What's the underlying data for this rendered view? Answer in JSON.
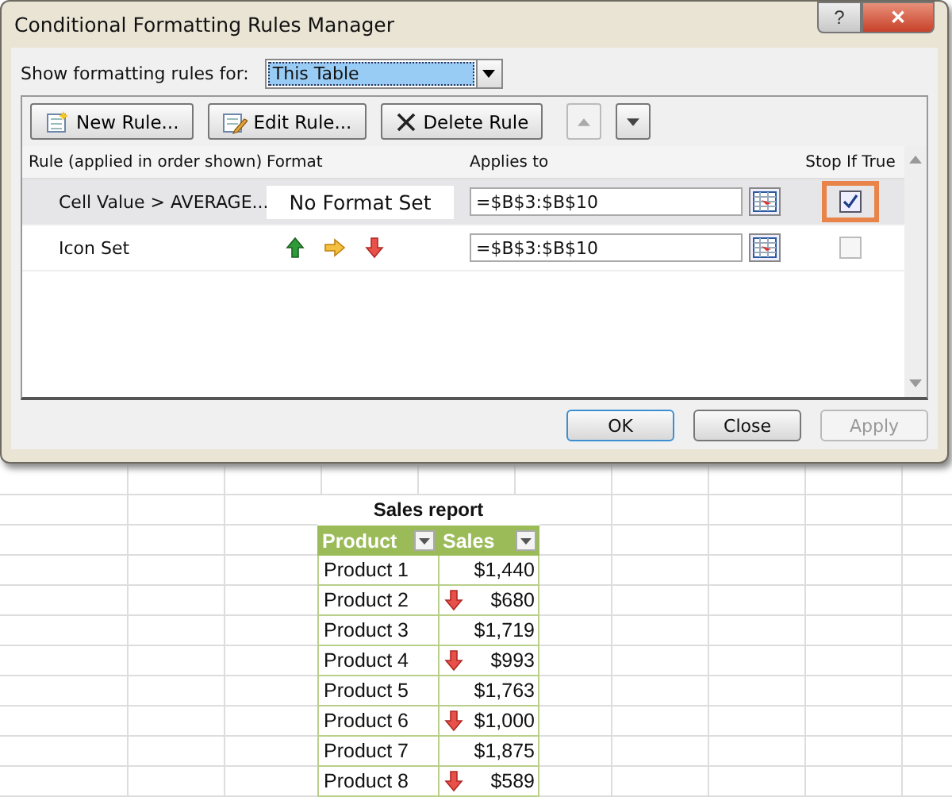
{
  "window": {
    "title": "Conditional Formatting Rules Manager",
    "help_button": "?",
    "close_button": "✕"
  },
  "show_rules_for": {
    "label": "Show formatting rules for:",
    "value": "This Table"
  },
  "toolbar": [
    "New Rule...",
    "Edit Rule...",
    "Delete Rule"
  ],
  "columns": [
    "Rule (applied in order shown)",
    "Format",
    "Applies to",
    "Stop If True"
  ],
  "rules": [
    {
      "kind": "cell_value",
      "rule": "Cell Value > AVERAGE...",
      "format": "No Format Set",
      "applies_to": "=$B$3:$B$10",
      "stop_if_true": true,
      "selected": true
    },
    {
      "kind": "icon_set",
      "rule": "Icon Set",
      "applies_to": "=$B$3:$B$10",
      "stop_if_true": false,
      "selected": false
    }
  ],
  "buttons": [
    {
      "label": "OK",
      "disabled": false
    },
    {
      "label": "Close",
      "disabled": false
    },
    {
      "label": "Apply",
      "disabled": true
    }
  ],
  "sheet": {
    "title": "Sales report",
    "columns": [
      "Product",
      "Sales"
    ],
    "rows": [
      {
        "product": "Product 1",
        "sales": "$1,440",
        "down_arrow": false
      },
      {
        "product": "Product 2",
        "sales": "$680",
        "down_arrow": true
      },
      {
        "product": "Product 3",
        "sales": "$1,719",
        "down_arrow": false
      },
      {
        "product": "Product 4",
        "sales": "$993",
        "down_arrow": true
      },
      {
        "product": "Product 5",
        "sales": "$1,763",
        "down_arrow": false
      },
      {
        "product": "Product 6",
        "sales": "$1,000",
        "down_arrow": true
      },
      {
        "product": "Product 7",
        "sales": "$1,875",
        "down_arrow": false
      },
      {
        "product": "Product 8",
        "sales": "$589",
        "down_arrow": true
      }
    ]
  }
}
